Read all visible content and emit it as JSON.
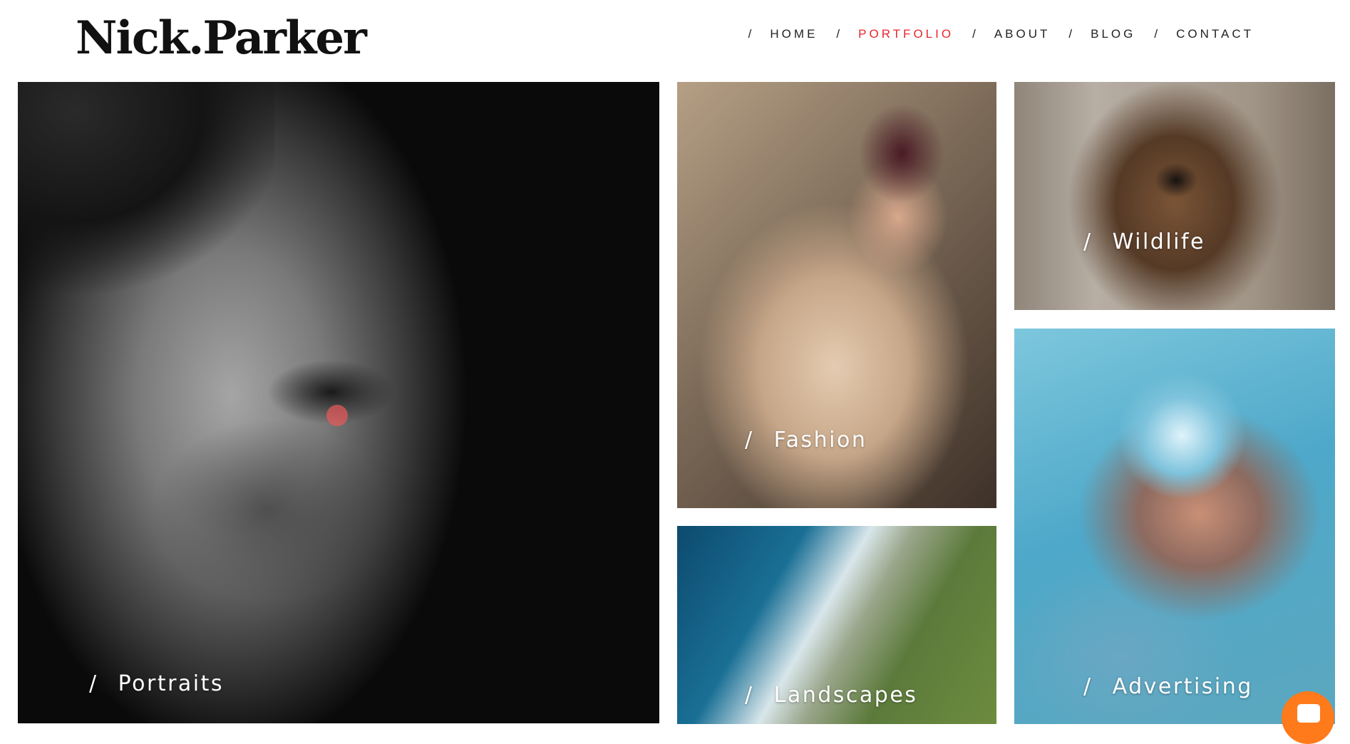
{
  "logo": {
    "text": "Nick.Parker"
  },
  "nav": {
    "separator": "/",
    "items": [
      {
        "label": "HOME",
        "active": false
      },
      {
        "label": "PORTFOLIO",
        "active": true
      },
      {
        "label": "ABOUT",
        "active": false
      },
      {
        "label": "BLOG",
        "active": false
      },
      {
        "label": "CONTACT",
        "active": false
      }
    ],
    "active_color": "#e8262e"
  },
  "portfolio": {
    "slash": "/",
    "tiles": {
      "portraits": {
        "label": "Portraits"
      },
      "fashion": {
        "label": "Fashion"
      },
      "wildlife": {
        "label": "Wildlife"
      },
      "landscapes": {
        "label": "Landscapes"
      },
      "advertising": {
        "label": "Advertising"
      }
    }
  },
  "chat": {
    "icon": "chat-icon",
    "color": "#ff7a1a"
  }
}
